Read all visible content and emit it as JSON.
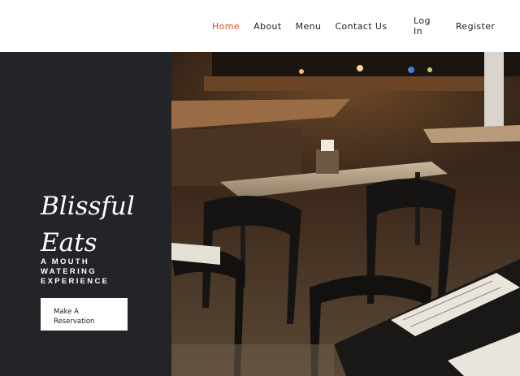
{
  "nav": {
    "items": [
      {
        "label": "Home",
        "active": true
      },
      {
        "label": "About",
        "active": false
      },
      {
        "label": "Menu",
        "active": false
      },
      {
        "label": "Contact Us",
        "active": false
      }
    ],
    "login_label": "Log In",
    "register_label": "Register"
  },
  "hero": {
    "brand_line1": "Blissful",
    "brand_line2": "Eats",
    "tagline_line1": "A MOUTH",
    "tagline_line2": "WATERING",
    "tagline_line3": "EXPERIENCE",
    "cta_line1": "Make A",
    "cta_line2": "Reservation"
  },
  "colors": {
    "accent": "#d9532c",
    "panel": "#222428",
    "text_dark": "#1f1f1f"
  }
}
